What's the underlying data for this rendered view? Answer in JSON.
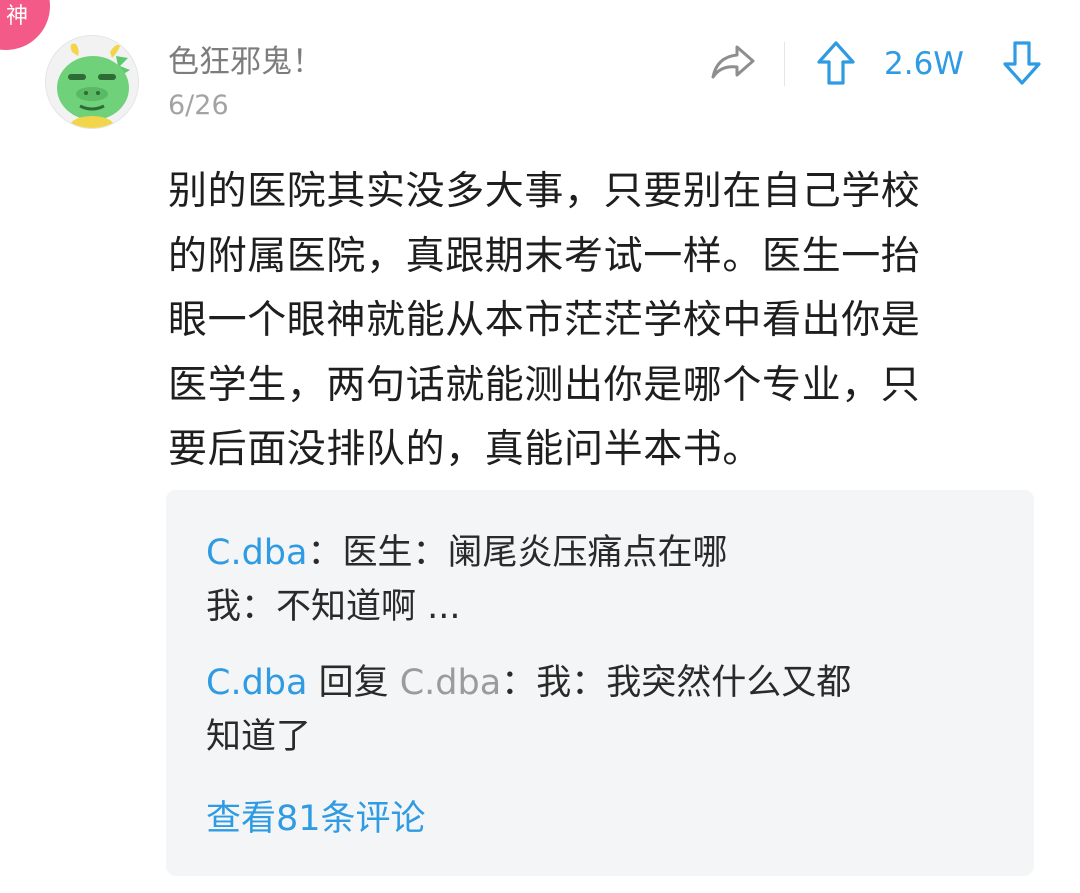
{
  "badge": {
    "label": "神",
    "color": "#f45a87"
  },
  "post": {
    "username": "色狂邪鬼！",
    "date": "6/26",
    "avatar_icon": "green-dragon-avatar",
    "actions": {
      "share_icon": "share-arrow-icon",
      "upvote_icon": "arrow-up-icon",
      "vote_count": "2.6W",
      "downvote_icon": "arrow-down-icon"
    },
    "body_lines": [
      "别的医院其实没多大事，只要别在自己学校",
      "的附属医院，真跟期末考试一样。医生一抬",
      "眼一个眼神就能从本市茫茫学校中看出你是",
      "医学生，两句话就能测出你是哪个专业，只",
      "要后面没排队的，真能问半本书。"
    ]
  },
  "replies": [
    {
      "user": "C.dba",
      "colon": "：",
      "text_line1": "医生：阑尾炎压痛点在哪",
      "text_line2": "我：不知道啊 ..."
    },
    {
      "user": "C.dba",
      "reply_word": " 回复 ",
      "reply_to": "C.dba",
      "colon": "：",
      "text_line1": "我：我突然什么又都",
      "text_line2": "知道了"
    }
  ],
  "more_comments": "查看81条评论",
  "colors": {
    "accent": "#2f9be3",
    "text": "#1e1e1e",
    "muted": "#7d7d7d",
    "reply_bg": "#f4f5f6"
  }
}
